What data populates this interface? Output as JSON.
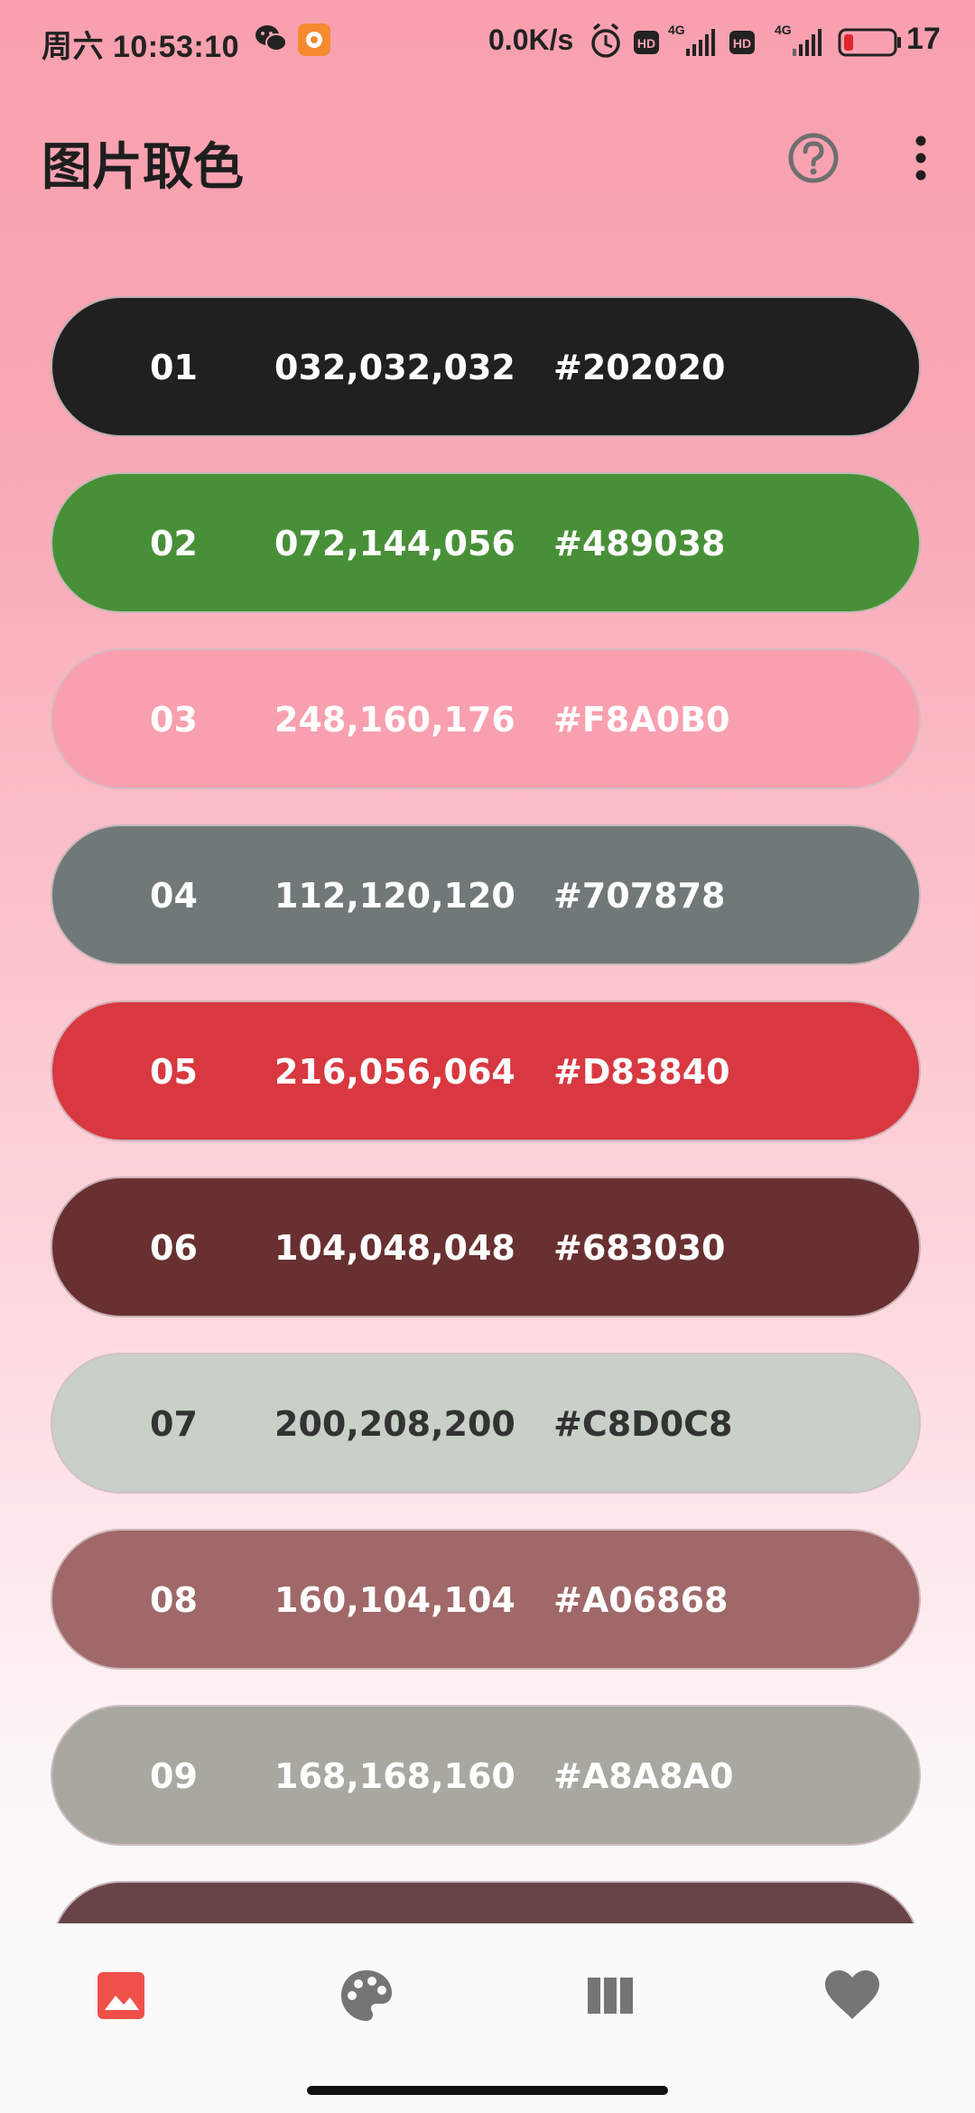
{
  "status_bar": {
    "time": "周六 10:53:10",
    "network_speed": "0.0K/s",
    "battery_level": "17",
    "icons": [
      "wechat-icon",
      "app-notification-icon",
      "alarm-icon",
      "hd-icon",
      "4g-signal-icon",
      "hd-icon",
      "4g-signal-icon",
      "battery-icon"
    ]
  },
  "app_bar": {
    "title": "图片取色",
    "actions": [
      "help-icon",
      "more-vert-icon"
    ]
  },
  "colors": [
    {
      "num": "01",
      "rgb": "032,032,032",
      "hex": "#202020",
      "swatch": "#202020",
      "text_color": "#ffffff"
    },
    {
      "num": "02",
      "rgb": "072,144,056",
      "hex": "#489038",
      "swatch": "#489038",
      "text_color": "#ffffff"
    },
    {
      "num": "03",
      "rgb": "248,160,176",
      "hex": "#F8A0B0",
      "swatch": "#F8A0B0",
      "text_color": "#ffffff"
    },
    {
      "num": "04",
      "rgb": "112,120,120",
      "hex": "#707878",
      "swatch": "#707878",
      "text_color": "#ffffff"
    },
    {
      "num": "05",
      "rgb": "216,056,064",
      "hex": "#D83840",
      "swatch": "#D83840",
      "text_color": "#ffffff"
    },
    {
      "num": "06",
      "rgb": "104,048,048",
      "hex": "#683030",
      "swatch": "#683030",
      "text_color": "#ffffff"
    },
    {
      "num": "07",
      "rgb": "200,208,200",
      "hex": "#C8D0C8",
      "swatch": "#C8D0C8",
      "text_color": "#333333"
    },
    {
      "num": "08",
      "rgb": "160,104,104",
      "hex": "#A06868",
      "swatch": "#A06868",
      "text_color": "#ffffff"
    },
    {
      "num": "09",
      "rgb": "168,168,160",
      "hex": "#A8A8A0",
      "swatch": "#A8A8A0",
      "text_color": "#ffffff"
    },
    {
      "num": "",
      "rgb": "",
      "hex": "",
      "swatch": "#684448",
      "text_color": "#ffffff"
    }
  ],
  "bottom_nav": {
    "items": [
      {
        "icon": "image-icon",
        "active": true,
        "color": "#f0504a"
      },
      {
        "icon": "palette-icon",
        "active": false,
        "color": "#757575"
      },
      {
        "icon": "columns-icon",
        "active": false,
        "color": "#757575"
      },
      {
        "icon": "heart-icon",
        "active": false,
        "color": "#757575"
      }
    ]
  },
  "theme": {
    "active_accent": "#f0504a",
    "inactive_icon": "#757575",
    "title_color": "#1e1e1e"
  }
}
